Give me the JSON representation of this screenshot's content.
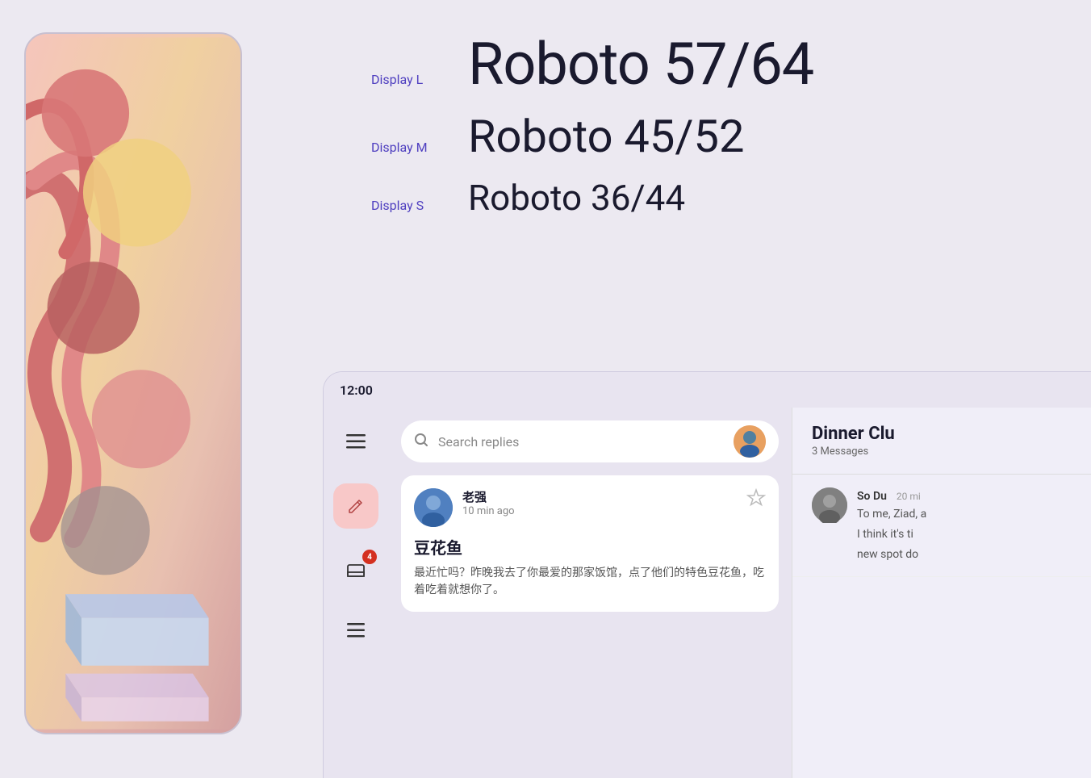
{
  "background_color": "#ece9f1",
  "left_panel": {
    "phone_mockup": true
  },
  "typography": {
    "rows": [
      {
        "label": "Display L",
        "text": "Roboto 57/64",
        "size_class": "display-l"
      },
      {
        "label": "Display M",
        "text": "Roboto 45/52",
        "size_class": "display-m"
      },
      {
        "label": "Display S",
        "text": "Roboto 36/44",
        "size_class": "display-s"
      }
    ]
  },
  "app_mockup": {
    "status_bar": {
      "time": "12:00"
    },
    "sidebar": {
      "icons": [
        {
          "name": "menu-icon",
          "symbol": "☰",
          "badge": null
        },
        {
          "name": "compose-icon",
          "symbol": "✏",
          "is_fab": true,
          "badge": null
        },
        {
          "name": "inbox-icon",
          "symbol": "📋",
          "badge": "4"
        },
        {
          "name": "list-icon",
          "symbol": "☰",
          "badge": null
        }
      ]
    },
    "search": {
      "placeholder": "Search replies"
    },
    "message": {
      "sender": "老强",
      "time": "10 min ago",
      "subject": "豆花鱼",
      "preview": "最近忙吗？昨晚我去了你最爱的那家饭馆，点了他们的特色豆花鱼，吃着吃着就想你了。"
    },
    "right_panel": {
      "title": "Dinner Clu",
      "count": "3 Messages",
      "sub_message": {
        "sender": "So Du",
        "time": "20 mi",
        "text_line1": "To me, Ziad, a",
        "text_line2": "I think it's ti",
        "text_line3": "new spot do"
      }
    }
  }
}
